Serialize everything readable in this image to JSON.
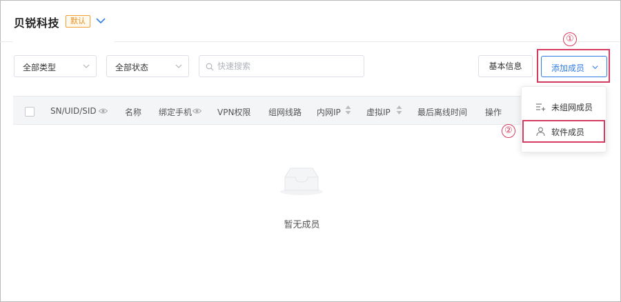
{
  "header": {
    "org_name": "贝锐科技",
    "default_badge": "默认"
  },
  "filters": {
    "type_select": "全部类型",
    "status_select": "全部状态",
    "search_placeholder": "快速搜索"
  },
  "actions": {
    "basic_info": "基本信息",
    "add_member": "添加成员"
  },
  "table": {
    "columns": [
      "SN/UID/SID",
      "名称",
      "绑定手机",
      "VPN权限",
      "组网线路",
      "内网IP",
      "虚拟IP",
      "最后离线时间",
      "操作"
    ],
    "empty_text": "暂无成员"
  },
  "dropdown": {
    "items": [
      "未组网成员",
      "软件成员"
    ]
  },
  "annotations": {
    "step1": "①",
    "step2": "②"
  },
  "colors": {
    "accent": "#2f7be6",
    "highlight": "#d63a5e",
    "badge": "#f0a030"
  }
}
